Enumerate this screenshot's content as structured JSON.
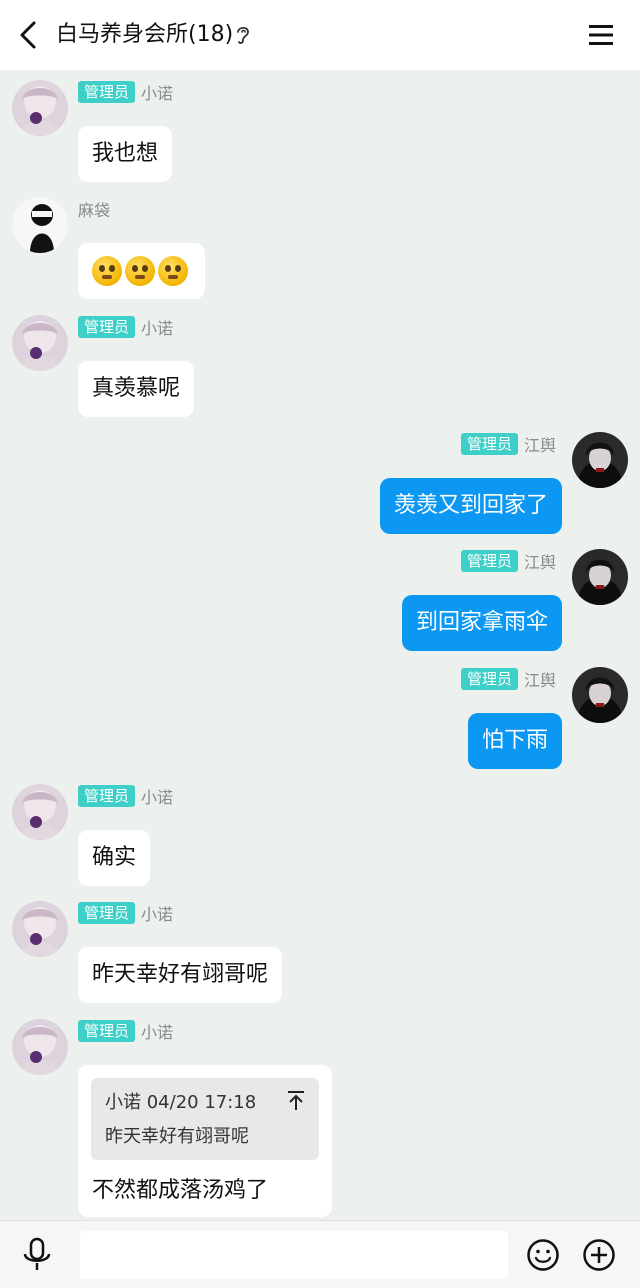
{
  "header": {
    "title": "白马养身会所(18)",
    "back_icon": "chevron-left-icon",
    "ear_icon": "ear-icon",
    "menu_icon": "hamburger-menu-icon"
  },
  "messages": [
    {
      "side": "left",
      "badge": "管理员",
      "nick": "小诺",
      "text": "我也想"
    },
    {
      "side": "left",
      "badge": "",
      "nick": "麻袋",
      "text": "",
      "emoji_count": 3
    },
    {
      "side": "left",
      "badge": "管理员",
      "nick": "小诺",
      "text": "真羡慕呢"
    },
    {
      "side": "right",
      "badge": "管理员",
      "nick": "江舆",
      "text": "羡羡又到回家了"
    },
    {
      "side": "right",
      "badge": "管理员",
      "nick": "江舆",
      "text": "到回家拿雨伞"
    },
    {
      "side": "right",
      "badge": "管理员",
      "nick": "江舆",
      "text": "怕下雨"
    },
    {
      "side": "left",
      "badge": "管理员",
      "nick": "小诺",
      "text": "确实"
    },
    {
      "side": "left",
      "badge": "管理员",
      "nick": "小诺",
      "text": "昨天幸好有翊哥呢"
    },
    {
      "side": "left",
      "badge": "管理员",
      "nick": "小诺",
      "text": "不然都成落汤鸡了",
      "quote": {
        "author_time": "小诺 04/20 17:18",
        "text": "昨天幸好有翊哥呢"
      }
    }
  ],
  "input": {
    "value": "",
    "placeholder": ""
  },
  "toolbar": {
    "voice_icon": "microphone-icon",
    "emoji_icon": "smiley-icon",
    "plus_icon": "plus-circle-icon"
  },
  "colors": {
    "background": "#ecf1ee",
    "self_bubble": "#0b97f2",
    "admin_badge": "#3fcfc9"
  }
}
